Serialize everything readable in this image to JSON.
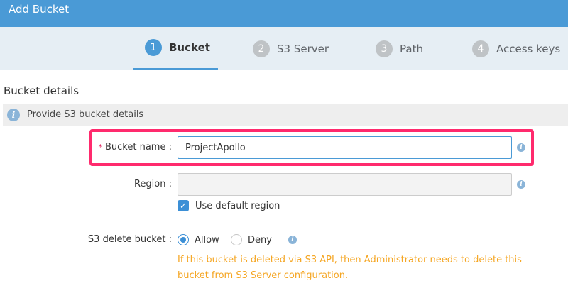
{
  "window": {
    "title": "Add Bucket"
  },
  "steps": [
    {
      "number": "1",
      "label": "Bucket",
      "active": true
    },
    {
      "number": "2",
      "label": "S3 Server",
      "active": false
    },
    {
      "number": "3",
      "label": "Path",
      "active": false
    },
    {
      "number": "4",
      "label": "Access keys",
      "active": false
    }
  ],
  "section": {
    "title": "Bucket details",
    "info_text": "Provide S3 bucket details"
  },
  "form": {
    "bucket_name": {
      "required_mark": "*",
      "label": "Bucket name",
      "separator": ":",
      "value": "ProjectApollo"
    },
    "region": {
      "label": "Region",
      "separator": ":",
      "value": "",
      "use_default_label": "Use default region",
      "use_default_checked": true
    },
    "delete_bucket": {
      "label": "S3 delete bucket",
      "separator": ":",
      "options": [
        "Allow",
        "Deny"
      ],
      "selected": "Allow",
      "warning": "If this bucket is deleted via S3 API, then Administrator needs to delete this bucket from S3 Server configuration."
    }
  },
  "icons": {
    "info": "i",
    "check": "✓"
  },
  "colors": {
    "accent": "#4a9ad6",
    "highlight": "#ff2a6d",
    "warning": "#f5a623"
  }
}
